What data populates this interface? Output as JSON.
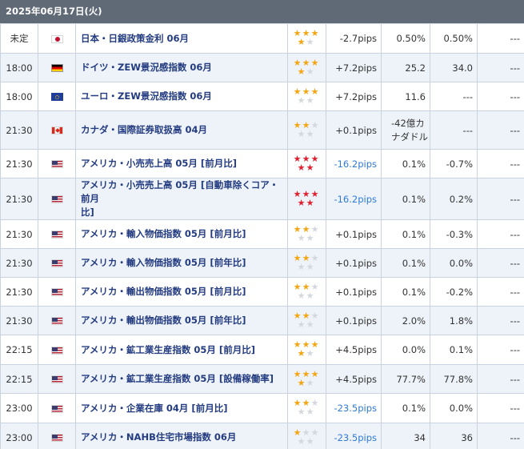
{
  "header": {
    "date_label": "2025年06月17日(火)"
  },
  "colors": {
    "header_bg": "#606a76",
    "title_text": "#233b80",
    "negative_blue": "#2f7bd6",
    "star_gold": "#f4a512",
    "star_red": "#e0202f",
    "star_gray": "#d4d8dd"
  },
  "rows": [
    {
      "time": "未定",
      "flag": "jp",
      "title": [
        "日本・日銀政策金利 06月"
      ],
      "star_color": "gold",
      "stars": 4,
      "impact": "-2.7pips",
      "impact_blue": false,
      "actual": [
        "0.50%"
      ],
      "forecast": "0.50%",
      "previous": "---"
    },
    {
      "time": "18:00",
      "flag": "de",
      "title": [
        "ドイツ・ZEW景況感指数 06月"
      ],
      "star_color": "gold",
      "stars": 4,
      "impact": "+7.2pips",
      "impact_blue": false,
      "actual": [
        "25.2"
      ],
      "forecast": "34.0",
      "previous": "---"
    },
    {
      "time": "18:00",
      "flag": "eu",
      "title": [
        "ユーロ・ZEW景況感指数 06月"
      ],
      "star_color": "gold",
      "stars": 3,
      "impact": "+7.2pips",
      "impact_blue": false,
      "actual": [
        "11.6"
      ],
      "forecast": "---",
      "previous": "---"
    },
    {
      "time": "21:30",
      "flag": "ca",
      "title": [
        "カナダ・国際証券取扱高 04月"
      ],
      "star_color": "gold",
      "stars": 2,
      "impact": "+0.1pips",
      "impact_blue": false,
      "actual": [
        "-42億カ",
        "ナダドル"
      ],
      "forecast": "---",
      "previous": "---"
    },
    {
      "time": "21:30",
      "flag": "us",
      "title": [
        "アメリカ・小売売上高 05月 [前月比]"
      ],
      "star_color": "red",
      "stars": 5,
      "impact": "-16.2pips",
      "impact_blue": true,
      "actual": [
        "0.1%"
      ],
      "forecast": "-0.7%",
      "previous": "---"
    },
    {
      "time": "21:30",
      "flag": "us",
      "title": [
        "アメリカ・小売売上高 05月 [自動車除くコア・前月",
        "比]"
      ],
      "star_color": "red",
      "stars": 5,
      "impact": "-16.2pips",
      "impact_blue": true,
      "actual": [
        "0.1%"
      ],
      "forecast": "0.2%",
      "previous": "---"
    },
    {
      "time": "21:30",
      "flag": "us",
      "title": [
        "アメリカ・輸入物価指数 05月 [前月比]"
      ],
      "star_color": "gold",
      "stars": 2,
      "impact": "+0.1pips",
      "impact_blue": false,
      "actual": [
        "0.1%"
      ],
      "forecast": "-0.3%",
      "previous": "---"
    },
    {
      "time": "21:30",
      "flag": "us",
      "title": [
        "アメリカ・輸入物価指数 05月 [前年比]"
      ],
      "star_color": "gold",
      "stars": 2,
      "impact": "+0.1pips",
      "impact_blue": false,
      "actual": [
        "0.1%"
      ],
      "forecast": "0.0%",
      "previous": "---"
    },
    {
      "time": "21:30",
      "flag": "us",
      "title": [
        "アメリカ・輸出物価指数 05月 [前月比]"
      ],
      "star_color": "gold",
      "stars": 2,
      "impact": "+0.1pips",
      "impact_blue": false,
      "actual": [
        "0.1%"
      ],
      "forecast": "-0.2%",
      "previous": "---"
    },
    {
      "time": "21:30",
      "flag": "us",
      "title": [
        "アメリカ・輸出物価指数 05月 [前年比]"
      ],
      "star_color": "gold",
      "stars": 2,
      "impact": "+0.1pips",
      "impact_blue": false,
      "actual": [
        "2.0%"
      ],
      "forecast": "1.8%",
      "previous": "---"
    },
    {
      "time": "22:15",
      "flag": "us",
      "title": [
        "アメリカ・鉱工業生産指数 05月 [前月比]"
      ],
      "star_color": "gold",
      "stars": 4,
      "impact": "+4.5pips",
      "impact_blue": false,
      "actual": [
        "0.0%"
      ],
      "forecast": "0.1%",
      "previous": "---"
    },
    {
      "time": "22:15",
      "flag": "us",
      "title": [
        "アメリカ・鉱工業生産指数 05月 [設備稼働率]"
      ],
      "star_color": "gold",
      "stars": 4,
      "impact": "+4.5pips",
      "impact_blue": false,
      "actual": [
        "77.7%"
      ],
      "forecast": "77.8%",
      "previous": "---"
    },
    {
      "time": "23:00",
      "flag": "us",
      "title": [
        "アメリカ・企業在庫 04月 [前月比]"
      ],
      "star_color": "gold",
      "stars": 2,
      "impact": "-23.5pips",
      "impact_blue": true,
      "actual": [
        "0.1%"
      ],
      "forecast": "0.0%",
      "previous": "---"
    },
    {
      "time": "23:00",
      "flag": "us",
      "title": [
        "アメリカ・NAHB住宅市場指数 06月"
      ],
      "star_color": "gold",
      "stars": 1,
      "impact": "-23.5pips",
      "impact_blue": true,
      "actual": [
        "34"
      ],
      "forecast": "36",
      "previous": "---"
    }
  ]
}
